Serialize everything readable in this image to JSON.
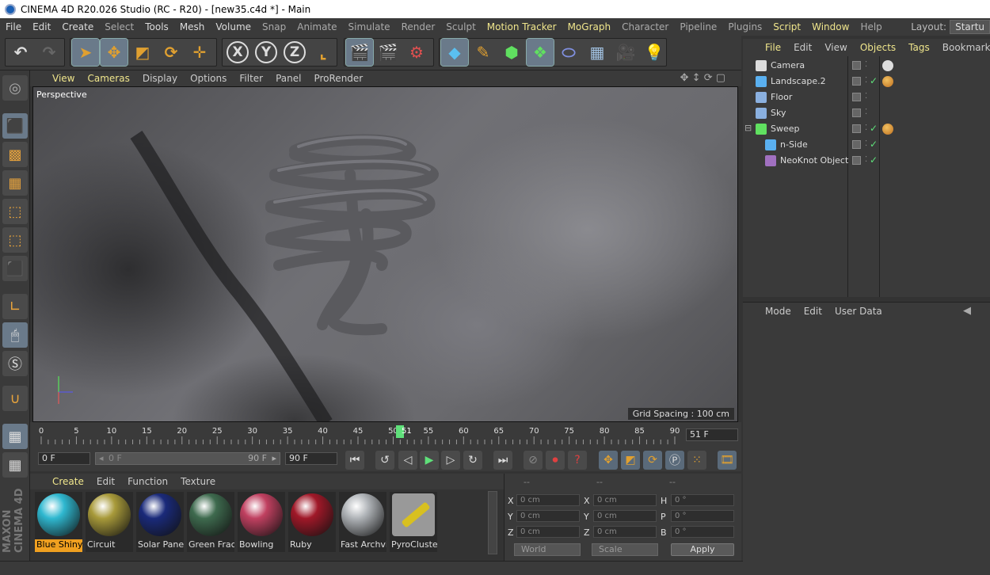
{
  "window": {
    "title": "CINEMA 4D R20.026 Studio (RC - R20) - [new35.c4d *] - Main"
  },
  "menubar": {
    "items": [
      "File",
      "Edit",
      "Create",
      "Select",
      "Tools",
      "Mesh",
      "Volume",
      "Snap",
      "Animate",
      "Simulate",
      "Render",
      "Sculpt",
      "Motion Tracker",
      "MoGraph",
      "Character",
      "Pipeline",
      "Plugins",
      "Script",
      "Window",
      "Help"
    ],
    "layout_label": "Layout:",
    "layout_value": "Startu"
  },
  "toolbar": {
    "icons": [
      "undo-icon",
      "redo-icon",
      "select-arrow-icon",
      "move-icon",
      "scale-icon",
      "rotate-icon",
      "live-selection-icon",
      "x-axis-icon",
      "y-axis-icon",
      "z-axis-icon",
      "coordinate-system-icon",
      "render-view-icon",
      "render-picture-icon",
      "render-settings-icon",
      "cube-icon",
      "pen-icon",
      "subdivision-icon",
      "array-icon",
      "nurbs-icon",
      "floor-icon",
      "camera-icon",
      "light-icon"
    ],
    "axis_labels": [
      "X",
      "Y",
      "Z"
    ]
  },
  "viewport": {
    "menu": [
      "View",
      "Cameras",
      "Display",
      "Options",
      "Filter",
      "Panel",
      "ProRender"
    ],
    "camera_label": "Perspective",
    "grid_spacing": "Grid Spacing : 100 cm"
  },
  "timeline": {
    "ticks": [
      "0",
      "5",
      "10",
      "15",
      "20",
      "25",
      "30",
      "35",
      "40",
      "45",
      "50",
      "55",
      "60",
      "65",
      "70",
      "75",
      "80",
      "85",
      "90"
    ],
    "current_frame": "51",
    "current_frame_field": "51 F"
  },
  "transport": {
    "start_field": "0 F",
    "range_start": "0 F",
    "range_end": "90 F",
    "end_field": "90 F"
  },
  "material_manager": {
    "menu": [
      "Create",
      "Edit",
      "Function",
      "Texture"
    ],
    "materials": [
      {
        "name": "Blue Shiny",
        "color": "#2fb8d0",
        "selected": true
      },
      {
        "name": "Circuit",
        "color": "#a89a3a",
        "selected": false
      },
      {
        "name": "Solar Panel",
        "color": "#1a2a7a",
        "selected": false
      },
      {
        "name": "Green Frac",
        "color": "#3e6a4e",
        "selected": false
      },
      {
        "name": "Bowling",
        "color": "#c04060",
        "selected": false
      },
      {
        "name": "Ruby",
        "color": "#a01828",
        "selected": false
      },
      {
        "name": "Fast Archvi",
        "color": "#b0b4b8",
        "selected": false
      },
      {
        "name": "PyroCluster",
        "color": "#d8c020",
        "selected": false
      }
    ]
  },
  "coordinates": {
    "headers": [
      "--",
      "--",
      "--"
    ],
    "rows": [
      {
        "a": "X",
        "av": "0 cm",
        "b": "X",
        "bv": "0 cm",
        "c": "H",
        "cv": "0 °"
      },
      {
        "a": "Y",
        "av": "0 cm",
        "b": "Y",
        "bv": "0 cm",
        "c": "P",
        "cv": "0 °"
      },
      {
        "a": "Z",
        "av": "0 cm",
        "b": "Z",
        "bv": "0 cm",
        "c": "B",
        "cv": "0 °"
      }
    ],
    "mode_world": "World",
    "mode_scale": "Scale",
    "apply": "Apply"
  },
  "object_manager": {
    "menu": [
      "File",
      "Edit",
      "View",
      "Objects",
      "Tags",
      "Bookmarks"
    ],
    "objects": [
      {
        "name": "Camera",
        "indent": 0,
        "check": false,
        "tag": "camera-tag"
      },
      {
        "name": "Landscape.2",
        "indent": 0,
        "check": true,
        "tag": "material-tag"
      },
      {
        "name": "Floor",
        "indent": 0,
        "check": false,
        "tag": ""
      },
      {
        "name": "Sky",
        "indent": 0,
        "check": false,
        "tag": ""
      },
      {
        "name": "Sweep",
        "indent": 0,
        "check": true,
        "tag": "material-tag"
      },
      {
        "name": "n-Side",
        "indent": 1,
        "check": true,
        "tag": ""
      },
      {
        "name": "NeoKnot Object",
        "indent": 1,
        "check": true,
        "tag": ""
      }
    ]
  },
  "attribute_manager": {
    "menu": [
      "Mode",
      "Edit",
      "User Data"
    ]
  },
  "colors": {
    "accent": "#f0e68c",
    "bg": "#3a3a3a",
    "active_tool": "#6a7a8a",
    "playhead": "#5fe07a"
  }
}
